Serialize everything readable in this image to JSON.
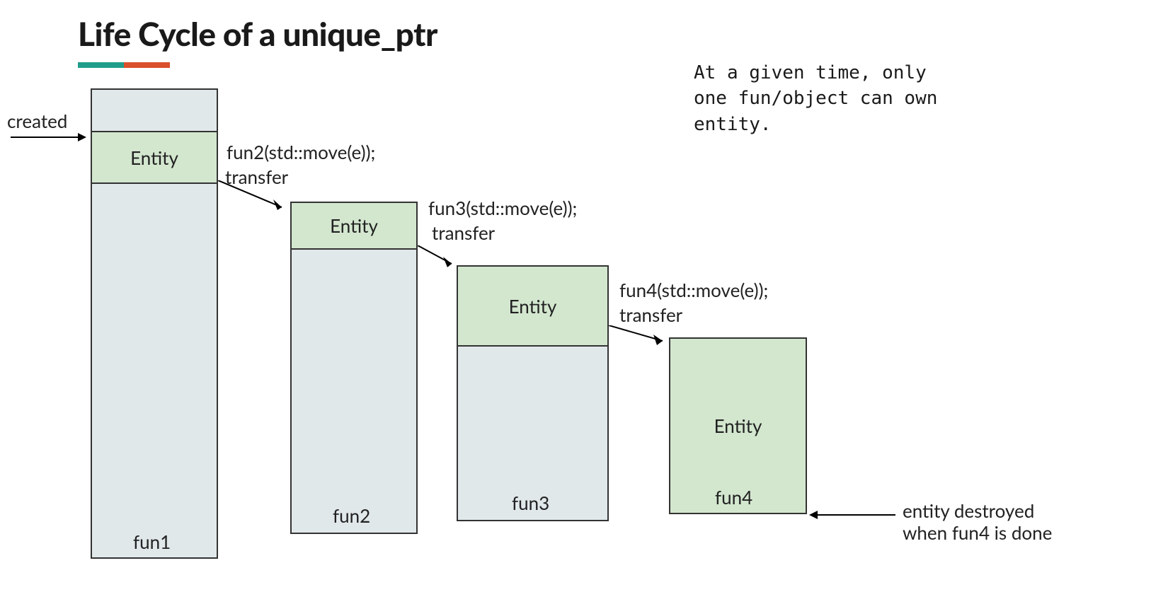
{
  "title": "Life Cycle of a unique_ptr",
  "note_line1": "At a given time, only",
  "note_line2": "one fun/object can own",
  "note_line3": "entity.",
  "created_label": "created",
  "entity_label": "Entity",
  "boxes": {
    "fun1": "fun1",
    "fun2": "fun2",
    "fun3": "fun3",
    "fun4": "fun4"
  },
  "transfers": {
    "t1_code": "fun2(std::move(e));",
    "t1_label": "transfer",
    "t2_code": "fun3(std::move(e));",
    "t2_label": "transfer",
    "t3_code": "fun4(std::move(e));",
    "t3_label": "transfer"
  },
  "destroyed_line1": "entity destroyed",
  "destroyed_line2": "when fun4 is done"
}
